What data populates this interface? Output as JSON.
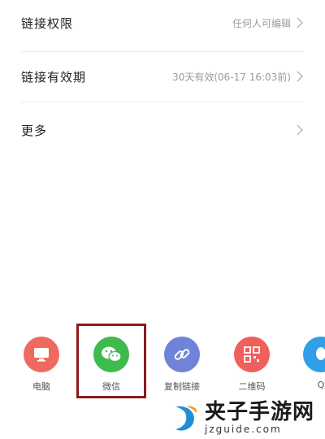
{
  "settings": {
    "rows": [
      {
        "label": "链接权限",
        "value": "任何人可编辑"
      },
      {
        "label": "链接有效期",
        "value": "30天有效(06-17 16:03前)"
      },
      {
        "label": "更多",
        "value": ""
      }
    ]
  },
  "share": {
    "items": [
      {
        "label": "电脑",
        "icon": "monitor-icon",
        "color": "#f0695e"
      },
      {
        "label": "微信",
        "icon": "wechat-icon",
        "color": "#3fba4d"
      },
      {
        "label": "复制链接",
        "icon": "link-icon",
        "color": "#6f83d8"
      },
      {
        "label": "二维码",
        "icon": "qr-code-icon",
        "color": "#ef5f5b"
      },
      {
        "label": "Q",
        "icon": "qq-icon",
        "color": "#2f9fe8"
      }
    ],
    "highlight_color": "#8b1a1a"
  },
  "watermark": {
    "title": "夹子手游网",
    "url": "jzguide.com"
  }
}
